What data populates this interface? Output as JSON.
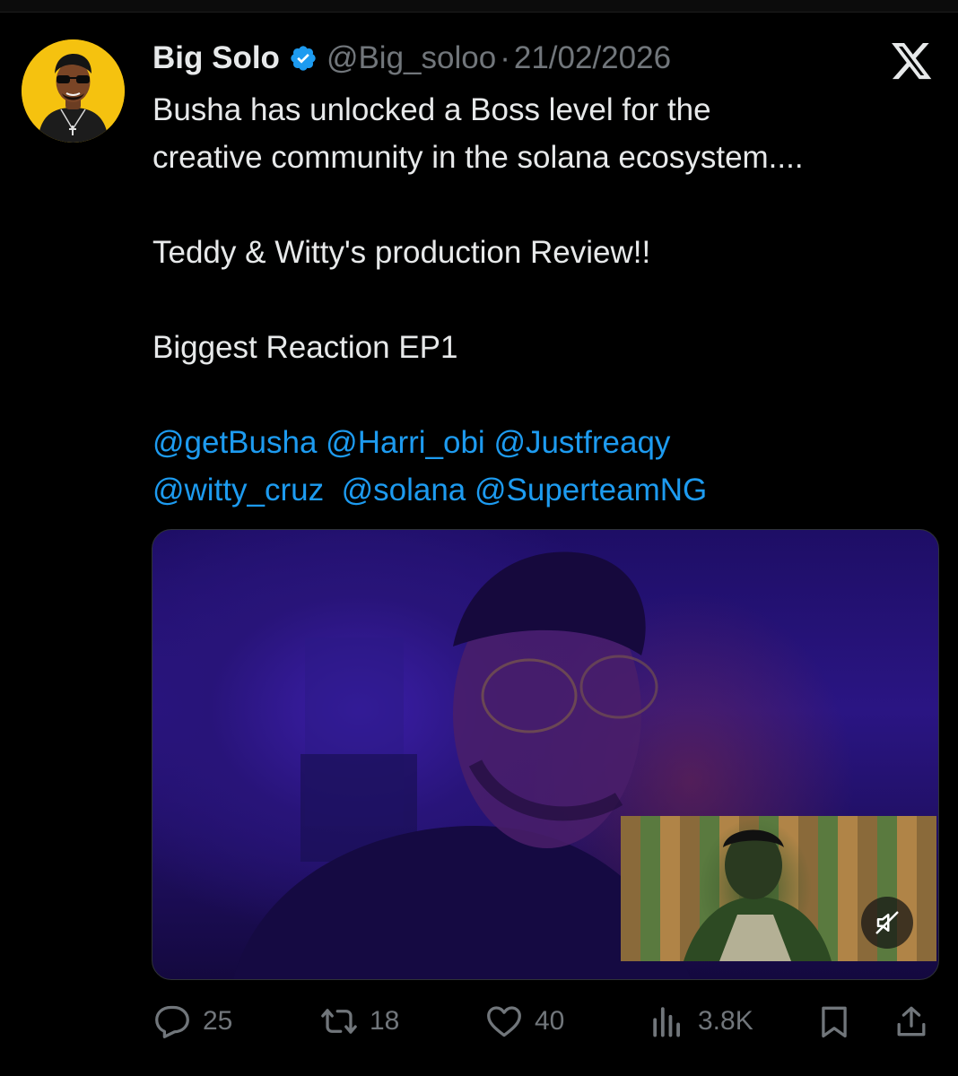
{
  "tweet": {
    "author": {
      "display_name": "Big Solo",
      "handle": "@Big_soloo",
      "verified": true,
      "avatar_bg": "#f5c20f"
    },
    "separator": "·",
    "date": "21/02/2026",
    "platform_icon": "x-logo-icon",
    "text_lines": [
      "Busha has unlocked a Boss level for the",
      "creative community in the solana ecosystem....",
      "",
      "Teddy & Witty's production Review!!",
      "",
      "Biggest Reaction EP1",
      ""
    ],
    "mention_lines": [
      [
        "@getBusha",
        "@Harri_obi",
        "@Justfreaqy"
      ],
      [
        "@witty_cruz",
        "@solana",
        "@SuperteamNG"
      ]
    ],
    "media": {
      "type": "video",
      "muted": true,
      "mute_icon": "volume-muted-icon"
    },
    "actions": {
      "replies": "25",
      "reposts": "18",
      "likes": "40",
      "views": "3.8K"
    }
  },
  "colors": {
    "background": "#000000",
    "text": "#e7e9ea",
    "secondary_text": "#71767b",
    "link": "#1d9bf0",
    "verified": "#1d9bf0"
  }
}
